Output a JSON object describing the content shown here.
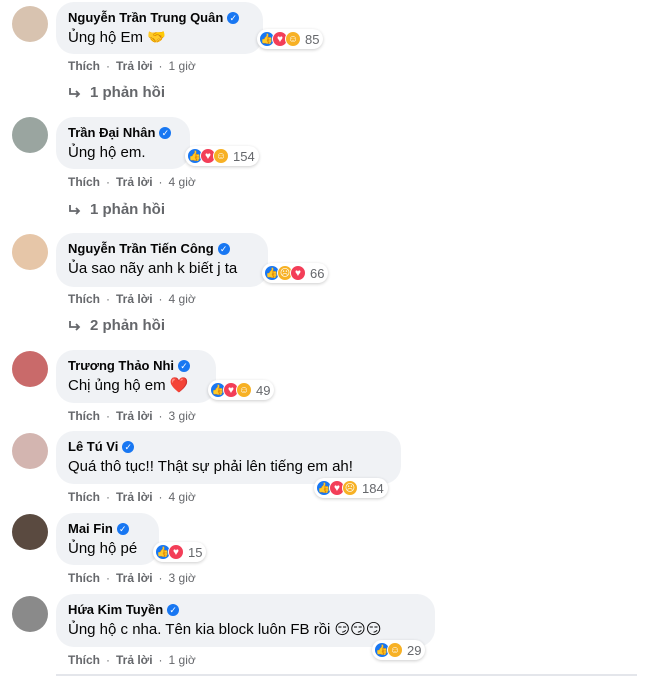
{
  "comments": [
    {
      "name": "Nguyễn Trần Trung Quân",
      "text": "Ủng hộ Em",
      "emoji": "🤝",
      "reaction_count": "85",
      "reactions": [
        "like-icon",
        "love-icon",
        "care-icon"
      ],
      "like_label": "Thích",
      "reply_label": "Trả lời",
      "time": "1 giờ",
      "replies_label": "1 phản hồi"
    },
    {
      "name": "Trần Đại Nhân",
      "text": "Ủng hộ em.",
      "emoji": "",
      "reaction_count": "154",
      "reactions": [
        "like-icon",
        "love-icon",
        "care-icon"
      ],
      "like_label": "Thích",
      "reply_label": "Trả lời",
      "time": "4 giờ",
      "replies_label": "1 phản hồi"
    },
    {
      "name": "Nguyễn Trần Tiến Công",
      "text": "Ủa sao nãy anh k biết j ta",
      "emoji": "",
      "reaction_count": "66",
      "reactions": [
        "like-icon",
        "sad-icon",
        "love-icon"
      ],
      "like_label": "Thích",
      "reply_label": "Trả lời",
      "time": "4 giờ",
      "replies_label": "2 phản hồi"
    },
    {
      "name": "Trương Thảo Nhi",
      "text": "Chị ủng hộ em",
      "emoji": "❤️",
      "reaction_count": "49",
      "reactions": [
        "like-icon",
        "love-icon",
        "care-icon"
      ],
      "like_label": "Thích",
      "reply_label": "Trả lời",
      "time": "3 giờ"
    },
    {
      "name": "Lê Tú Vi",
      "text": "Quá thô tục!! Thật sự phải lên tiếng em ah!",
      "emoji": "",
      "reaction_count": "184",
      "reactions": [
        "like-icon",
        "love-icon",
        "sad-icon"
      ],
      "like_label": "Thích",
      "reply_label": "Trả lời",
      "time": "4 giờ"
    },
    {
      "name": "Mai Fin",
      "text": "Ủng hộ pé",
      "emoji": "",
      "reaction_count": "15",
      "reactions": [
        "like-icon",
        "love-icon"
      ],
      "like_label": "Thích",
      "reply_label": "Trả lời",
      "time": "3 giờ"
    },
    {
      "name": "Hứa Kim Tuyền",
      "text": "Ủng hộ c nha. Tên kia block luôn FB rồi",
      "emoji": "😏😏😏",
      "reaction_count": "29",
      "reactions": [
        "like-icon",
        "care-icon"
      ],
      "like_label": "Thích",
      "reply_label": "Trả lời",
      "time": "1 giờ"
    }
  ],
  "colors": {
    "bubble": "#f0f2f5",
    "like": "#1877f2",
    "love": "#f33e58",
    "care": "#f7b125",
    "meta": "#65676b"
  }
}
